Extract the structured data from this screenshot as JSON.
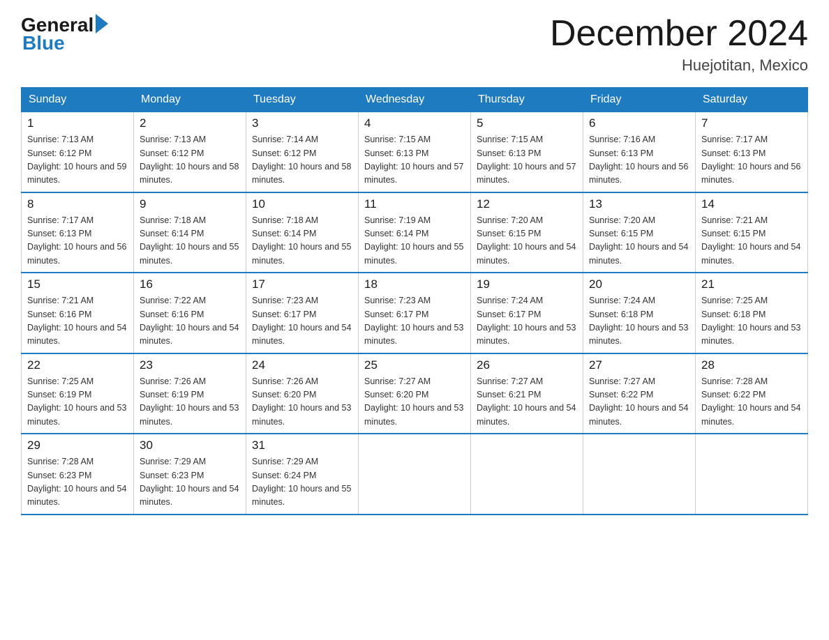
{
  "header": {
    "logo_general": "General",
    "logo_blue": "Blue",
    "title": "December 2024",
    "subtitle": "Huejotitan, Mexico"
  },
  "days_of_week": [
    "Sunday",
    "Monday",
    "Tuesday",
    "Wednesday",
    "Thursday",
    "Friday",
    "Saturday"
  ],
  "weeks": [
    [
      {
        "day": "1",
        "sunrise": "7:13 AM",
        "sunset": "6:12 PM",
        "daylight": "10 hours and 59 minutes."
      },
      {
        "day": "2",
        "sunrise": "7:13 AM",
        "sunset": "6:12 PM",
        "daylight": "10 hours and 58 minutes."
      },
      {
        "day": "3",
        "sunrise": "7:14 AM",
        "sunset": "6:12 PM",
        "daylight": "10 hours and 58 minutes."
      },
      {
        "day": "4",
        "sunrise": "7:15 AM",
        "sunset": "6:13 PM",
        "daylight": "10 hours and 57 minutes."
      },
      {
        "day": "5",
        "sunrise": "7:15 AM",
        "sunset": "6:13 PM",
        "daylight": "10 hours and 57 minutes."
      },
      {
        "day": "6",
        "sunrise": "7:16 AM",
        "sunset": "6:13 PM",
        "daylight": "10 hours and 56 minutes."
      },
      {
        "day": "7",
        "sunrise": "7:17 AM",
        "sunset": "6:13 PM",
        "daylight": "10 hours and 56 minutes."
      }
    ],
    [
      {
        "day": "8",
        "sunrise": "7:17 AM",
        "sunset": "6:13 PM",
        "daylight": "10 hours and 56 minutes."
      },
      {
        "day": "9",
        "sunrise": "7:18 AM",
        "sunset": "6:14 PM",
        "daylight": "10 hours and 55 minutes."
      },
      {
        "day": "10",
        "sunrise": "7:18 AM",
        "sunset": "6:14 PM",
        "daylight": "10 hours and 55 minutes."
      },
      {
        "day": "11",
        "sunrise": "7:19 AM",
        "sunset": "6:14 PM",
        "daylight": "10 hours and 55 minutes."
      },
      {
        "day": "12",
        "sunrise": "7:20 AM",
        "sunset": "6:15 PM",
        "daylight": "10 hours and 54 minutes."
      },
      {
        "day": "13",
        "sunrise": "7:20 AM",
        "sunset": "6:15 PM",
        "daylight": "10 hours and 54 minutes."
      },
      {
        "day": "14",
        "sunrise": "7:21 AM",
        "sunset": "6:15 PM",
        "daylight": "10 hours and 54 minutes."
      }
    ],
    [
      {
        "day": "15",
        "sunrise": "7:21 AM",
        "sunset": "6:16 PM",
        "daylight": "10 hours and 54 minutes."
      },
      {
        "day": "16",
        "sunrise": "7:22 AM",
        "sunset": "6:16 PM",
        "daylight": "10 hours and 54 minutes."
      },
      {
        "day": "17",
        "sunrise": "7:23 AM",
        "sunset": "6:17 PM",
        "daylight": "10 hours and 54 minutes."
      },
      {
        "day": "18",
        "sunrise": "7:23 AM",
        "sunset": "6:17 PM",
        "daylight": "10 hours and 53 minutes."
      },
      {
        "day": "19",
        "sunrise": "7:24 AM",
        "sunset": "6:17 PM",
        "daylight": "10 hours and 53 minutes."
      },
      {
        "day": "20",
        "sunrise": "7:24 AM",
        "sunset": "6:18 PM",
        "daylight": "10 hours and 53 minutes."
      },
      {
        "day": "21",
        "sunrise": "7:25 AM",
        "sunset": "6:18 PM",
        "daylight": "10 hours and 53 minutes."
      }
    ],
    [
      {
        "day": "22",
        "sunrise": "7:25 AM",
        "sunset": "6:19 PM",
        "daylight": "10 hours and 53 minutes."
      },
      {
        "day": "23",
        "sunrise": "7:26 AM",
        "sunset": "6:19 PM",
        "daylight": "10 hours and 53 minutes."
      },
      {
        "day": "24",
        "sunrise": "7:26 AM",
        "sunset": "6:20 PM",
        "daylight": "10 hours and 53 minutes."
      },
      {
        "day": "25",
        "sunrise": "7:27 AM",
        "sunset": "6:20 PM",
        "daylight": "10 hours and 53 minutes."
      },
      {
        "day": "26",
        "sunrise": "7:27 AM",
        "sunset": "6:21 PM",
        "daylight": "10 hours and 54 minutes."
      },
      {
        "day": "27",
        "sunrise": "7:27 AM",
        "sunset": "6:22 PM",
        "daylight": "10 hours and 54 minutes."
      },
      {
        "day": "28",
        "sunrise": "7:28 AM",
        "sunset": "6:22 PM",
        "daylight": "10 hours and 54 minutes."
      }
    ],
    [
      {
        "day": "29",
        "sunrise": "7:28 AM",
        "sunset": "6:23 PM",
        "daylight": "10 hours and 54 minutes."
      },
      {
        "day": "30",
        "sunrise": "7:29 AM",
        "sunset": "6:23 PM",
        "daylight": "10 hours and 54 minutes."
      },
      {
        "day": "31",
        "sunrise": "7:29 AM",
        "sunset": "6:24 PM",
        "daylight": "10 hours and 55 minutes."
      },
      null,
      null,
      null,
      null
    ]
  ]
}
